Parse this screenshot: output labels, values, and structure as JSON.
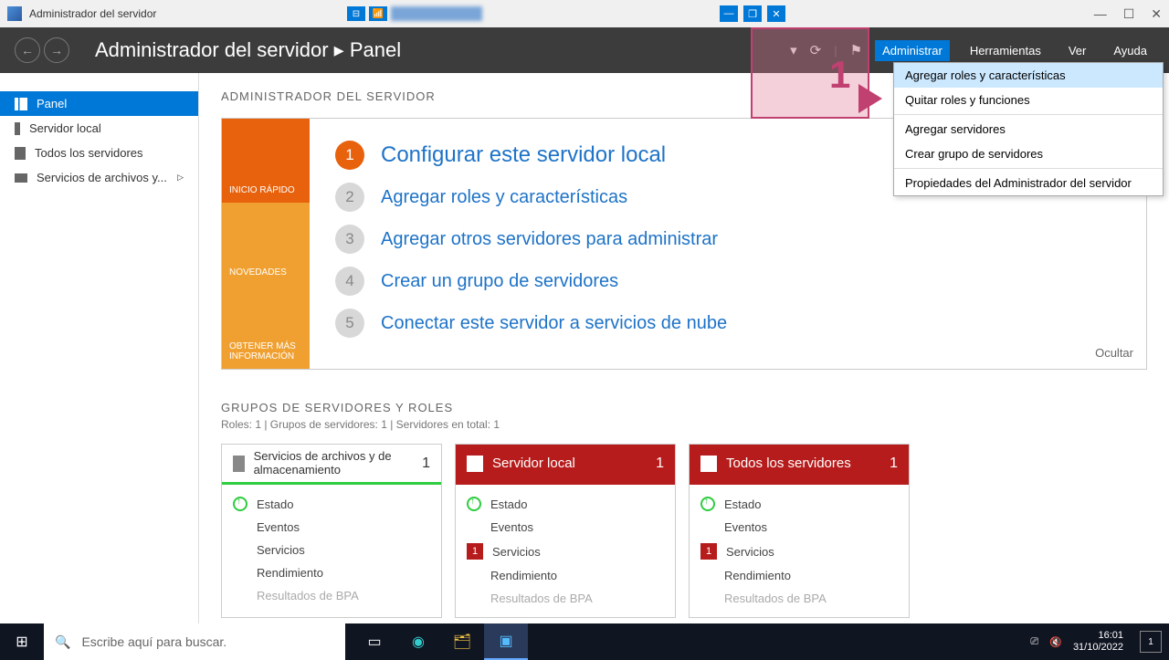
{
  "titlebar": {
    "app_title": "Administrador del servidor"
  },
  "header": {
    "breadcrumb": "Administrador del servidor ▸ Panel",
    "menu": {
      "administrar": "Administrar",
      "herramientas": "Herramientas",
      "ver": "Ver",
      "ayuda": "Ayuda"
    }
  },
  "dropdown": {
    "items": [
      "Agregar roles y características",
      "Quitar roles y funciones",
      "Agregar servidores",
      "Crear grupo de servidores",
      "Propiedades del Administrador del servidor"
    ]
  },
  "sidebar": {
    "items": [
      {
        "label": "Panel"
      },
      {
        "label": "Servidor local"
      },
      {
        "label": "Todos los servidores"
      },
      {
        "label": "Servicios de archivos y..."
      }
    ]
  },
  "welcome": {
    "title": "ADMINISTRADOR DEL SERVIDOR",
    "tabs": {
      "quick": "INICIO RÁPIDO",
      "new": "NOVEDADES",
      "more": "OBTENER MÁS INFORMACIÓN"
    },
    "steps": [
      {
        "n": "1",
        "text": "Configurar este servidor local"
      },
      {
        "n": "2",
        "text": "Agregar roles y características"
      },
      {
        "n": "3",
        "text": "Agregar otros servidores para administrar"
      },
      {
        "n": "4",
        "text": "Crear un grupo de servidores"
      },
      {
        "n": "5",
        "text": "Conectar este servidor a servicios de nube"
      }
    ],
    "hide": "Ocultar"
  },
  "groups": {
    "title": "GRUPOS DE SERVIDORES Y ROLES",
    "sub": "Roles: 1   |   Grupos de servidores: 1   |   Servidores en total: 1"
  },
  "tiles": [
    {
      "title": "Servicios de archivos y de almacenamiento",
      "count": "1",
      "color": "green",
      "rows": [
        "Estado",
        "Eventos",
        "Servicios",
        "Rendimiento",
        "Resultados de BPA"
      ],
      "badge": null
    },
    {
      "title": "Servidor local",
      "count": "1",
      "color": "red",
      "rows": [
        "Estado",
        "Eventos",
        "Servicios",
        "Rendimiento",
        "Resultados de BPA"
      ],
      "badge": "1"
    },
    {
      "title": "Todos los servidores",
      "count": "1",
      "color": "red",
      "rows": [
        "Estado",
        "Eventos",
        "Servicios",
        "Rendimiento",
        "Resultados de BPA"
      ],
      "badge": "1"
    }
  ],
  "annotation": {
    "num": "1"
  },
  "taskbar": {
    "search_placeholder": "Escribe aquí para buscar.",
    "time": "16:01",
    "date": "31/10/2022",
    "notif_count": "1"
  }
}
